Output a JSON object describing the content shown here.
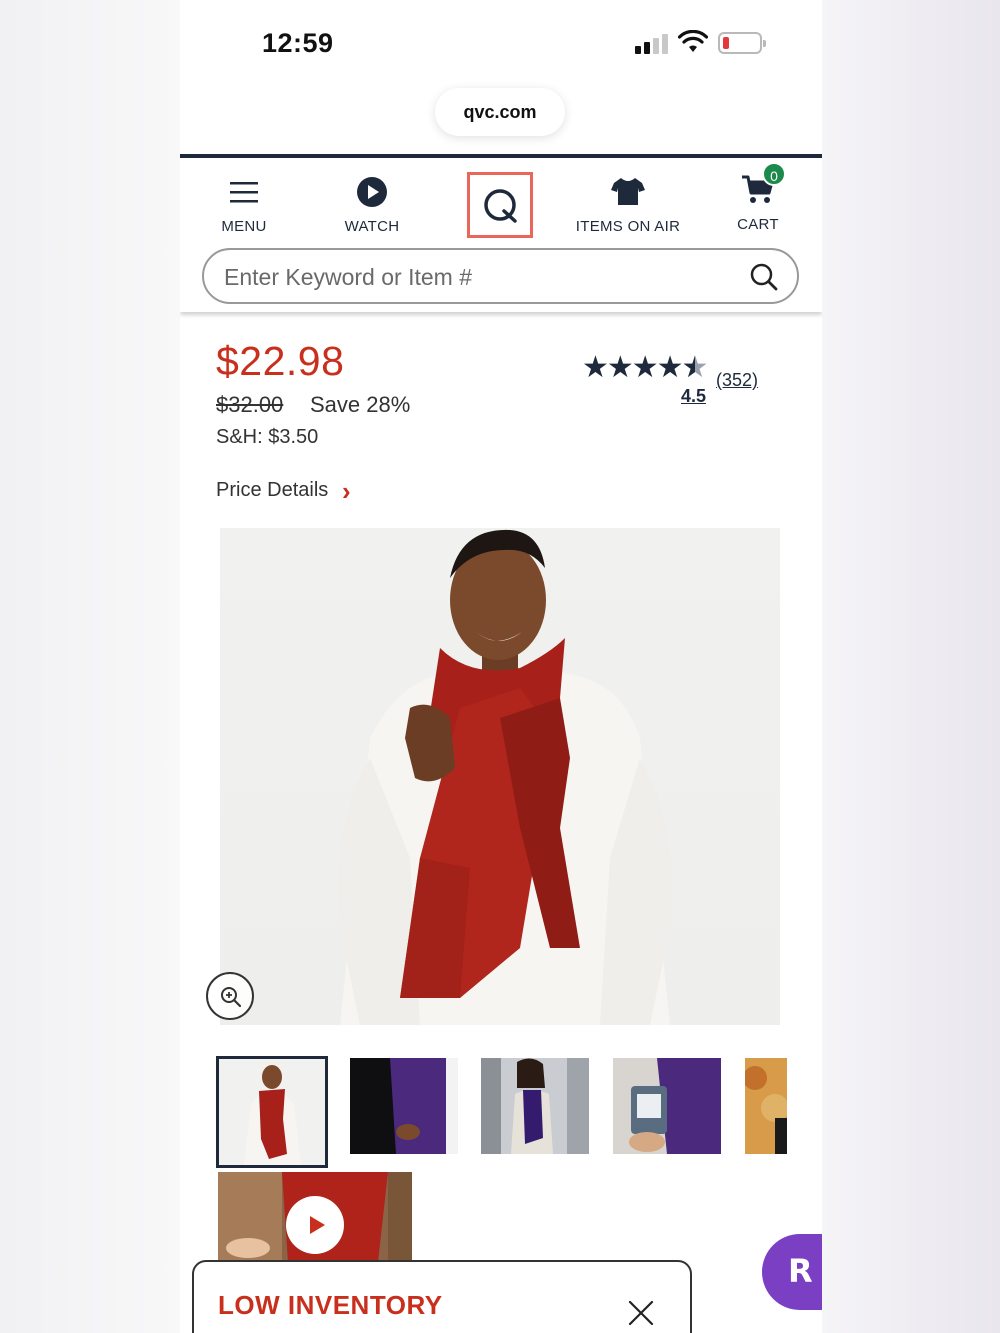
{
  "status_bar": {
    "time": "12:59",
    "battery_color": "#e5383b"
  },
  "browser": {
    "url": "qvc.com"
  },
  "nav": {
    "menu_label": "MENU",
    "watch_label": "WATCH",
    "items_on_air_label": "ITEMS ON AIR",
    "cart_label": "CART",
    "cart_count": "0"
  },
  "search": {
    "placeholder": "Enter Keyword or Item #"
  },
  "product": {
    "price": "$22.98",
    "was_price": "$32.00",
    "save": "Save 28%",
    "shipping": "S&H: $3.50",
    "rating": "4.5",
    "review_count": "(352)",
    "price_details_label": "Price Details"
  },
  "banner": {
    "low_inventory": "LOW INVENTORY"
  },
  "fab": {
    "letter": "R"
  },
  "colors": {
    "brand_red": "#c8301d",
    "navy": "#1e2a3c",
    "fab_purple": "#7b3fc4",
    "cart_badge": "#1b8a4a"
  }
}
